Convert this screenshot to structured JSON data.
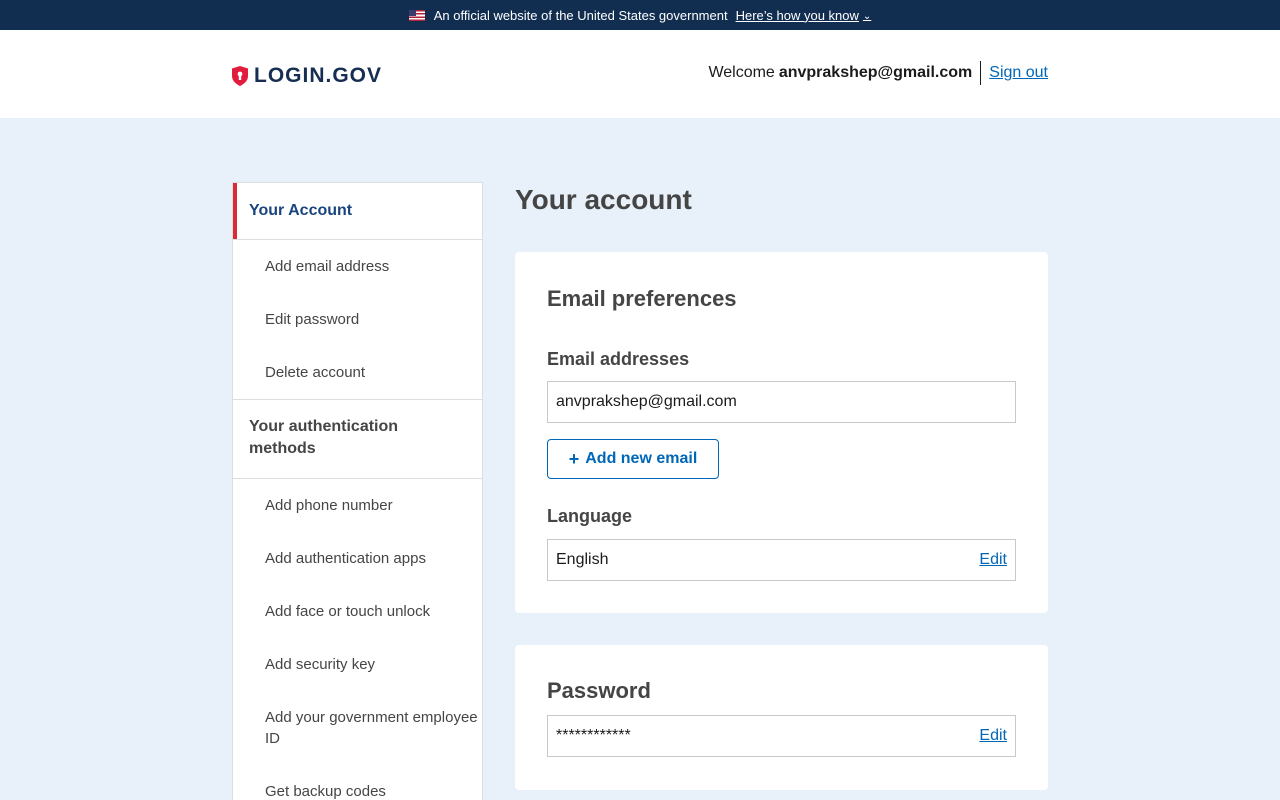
{
  "banner": {
    "official_text": "An official website of the United States government",
    "howto_link": "Here’s how you know",
    "flag_icon": "us-flag-icon",
    "chevron_icon": "chevron-down-icon"
  },
  "header": {
    "logo_text": "LOGIN.GOV",
    "welcome": "Welcome",
    "user_email": "anvprakshep@gmail.com",
    "signout": "Sign out"
  },
  "sidenav": {
    "account_heading": "Your Account",
    "account_items": [
      "Add email address",
      "Edit password",
      "Delete account"
    ],
    "auth_heading": "Your authentication methods",
    "auth_items": [
      "Add phone number",
      "Add authentication apps",
      "Add face or touch unlock",
      "Add security key",
      "Add your government employee ID",
      "Get backup codes"
    ]
  },
  "main": {
    "page_title": "Your account",
    "email_card": {
      "title": "Email preferences",
      "emails_label": "Email addresses",
      "email_value": "anvprakshep@gmail.com",
      "add_email_button": "Add new email",
      "language_label": "Language",
      "language_value": "English",
      "language_edit": "Edit"
    },
    "password_card": {
      "title": "Password",
      "password_value": "************",
      "password_edit": "Edit"
    }
  },
  "colors": {
    "banner_bg": "#112e51",
    "page_bg": "#e8f1f9",
    "link": "#0067b8",
    "active_accent": "#d72d3a",
    "active_text": "#1a4480"
  }
}
